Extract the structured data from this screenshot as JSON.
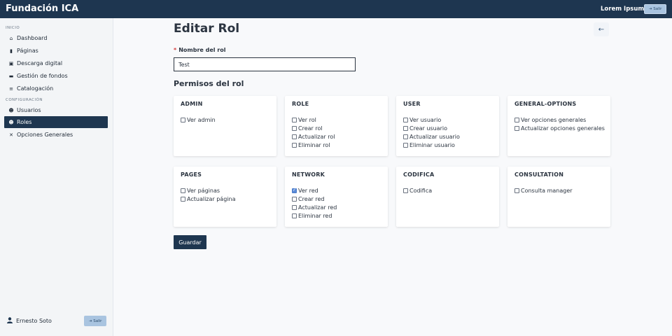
{
  "header": {
    "brand": "Fundación ICA",
    "user_name": "Lorem Ipsum",
    "exit_label": "Salir"
  },
  "sidebar": {
    "section_inicio": "INICIO",
    "section_config": "CONFIGURACIÓN",
    "items": [
      {
        "label": "Dashboard",
        "icon": "home-icon"
      },
      {
        "label": "Páginas",
        "icon": "file-icon"
      },
      {
        "label": "Descarga digital",
        "icon": "download-icon"
      },
      {
        "label": "Gestión de fondos",
        "icon": "folder-icon"
      },
      {
        "label": "Catalogación",
        "icon": "stack-icon"
      },
      {
        "label": "Usuarios",
        "icon": "users-icon"
      },
      {
        "label": "Roles",
        "icon": "user-cog-icon",
        "active": true
      },
      {
        "label": "Opciones Generales",
        "icon": "tools-icon"
      }
    ],
    "footer_user": "Ernesto Soto",
    "footer_exit": "Salir"
  },
  "main": {
    "title": "Editar Rol",
    "name_label": "Nombre del rol",
    "required_mark": "*",
    "name_value": "Test",
    "permissions_title": "Permisos del rol",
    "save_label": "Guardar",
    "back_icon": "arrow-left-icon",
    "cards": [
      {
        "title": "ADMIN",
        "perms": [
          {
            "label": "Ver admin",
            "checked": false
          }
        ]
      },
      {
        "title": "ROLE",
        "perms": [
          {
            "label": "Ver rol",
            "checked": false
          },
          {
            "label": "Crear rol",
            "checked": false
          },
          {
            "label": "Actualizar rol",
            "checked": false
          },
          {
            "label": "Eliminar rol",
            "checked": false
          }
        ]
      },
      {
        "title": "USER",
        "perms": [
          {
            "label": "Ver usuario",
            "checked": false
          },
          {
            "label": "Crear usuario",
            "checked": false
          },
          {
            "label": "Actualizar usuario",
            "checked": false
          },
          {
            "label": "Eliminar usuario",
            "checked": false
          }
        ]
      },
      {
        "title": "GENERAL-OPTIONS",
        "perms": [
          {
            "label": "Ver opciones generales",
            "checked": false
          },
          {
            "label": "Actualizar opciones generales",
            "checked": false
          }
        ]
      },
      {
        "title": "PAGES",
        "perms": [
          {
            "label": "Ver páginas",
            "checked": false
          },
          {
            "label": "Actualizar página",
            "checked": false
          }
        ]
      },
      {
        "title": "NETWORK",
        "perms": [
          {
            "label": "Ver red",
            "checked": true
          },
          {
            "label": "Crear red",
            "checked": false
          },
          {
            "label": "Actualizar red",
            "checked": false
          },
          {
            "label": "Eliminar red",
            "checked": false
          }
        ]
      },
      {
        "title": "CODIFICA",
        "perms": [
          {
            "label": "Codifica",
            "checked": false
          }
        ]
      },
      {
        "title": "CONSULTATION",
        "perms": [
          {
            "label": "Consulta manager",
            "checked": false
          }
        ]
      }
    ]
  }
}
